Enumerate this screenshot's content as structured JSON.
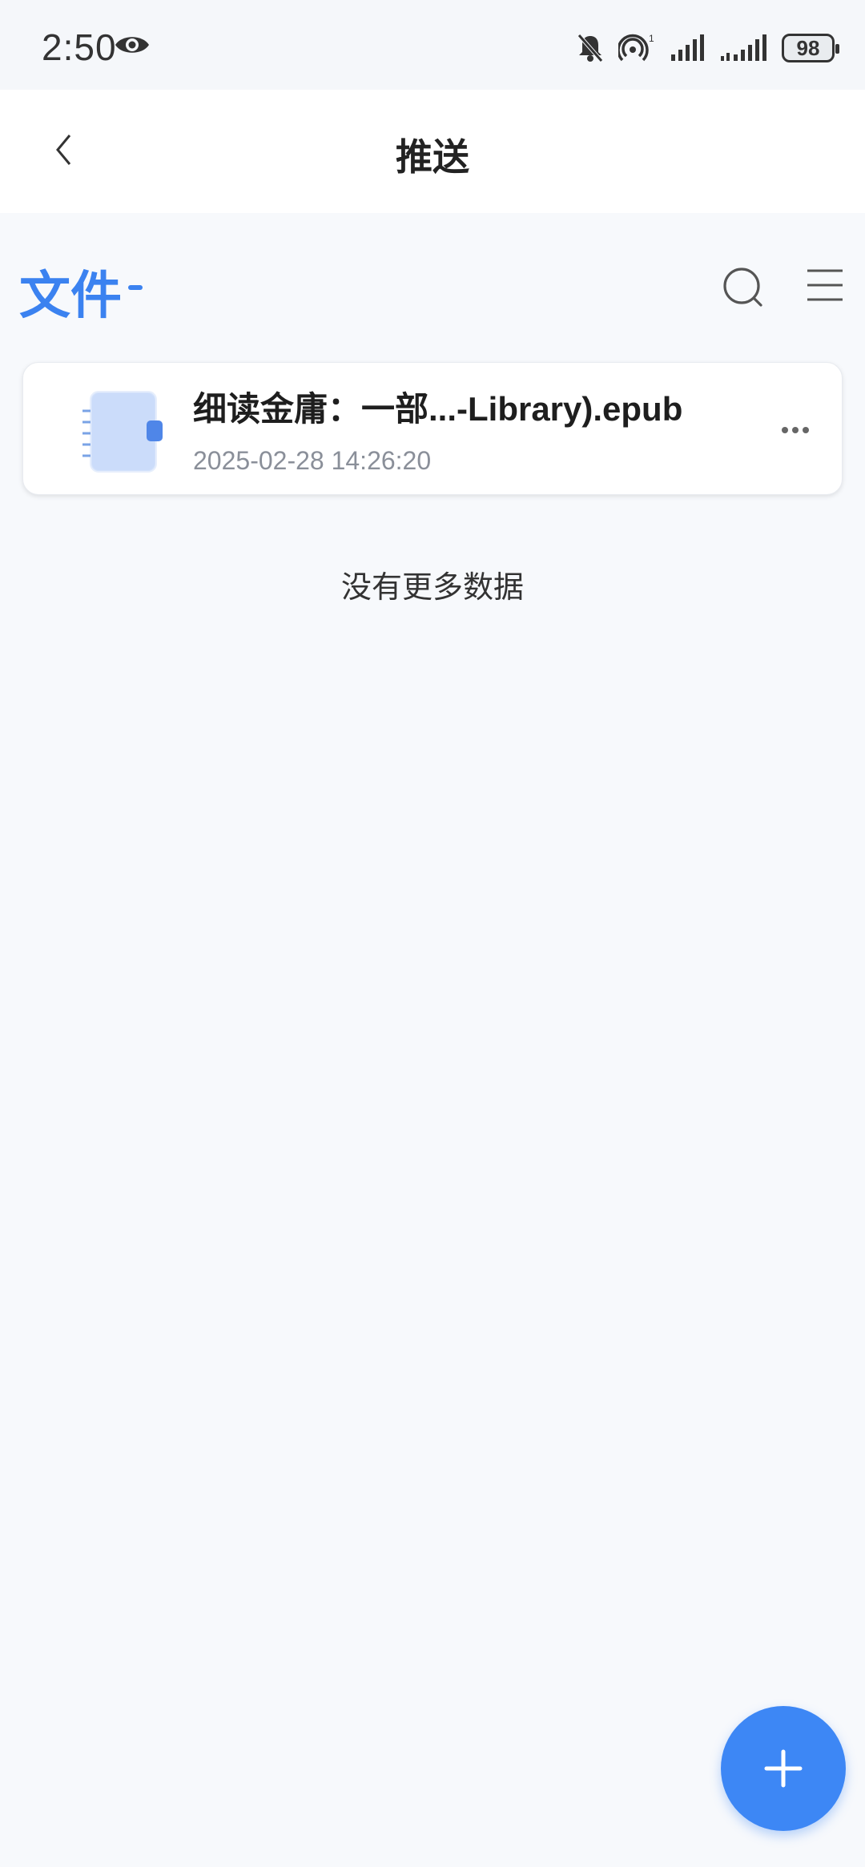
{
  "status_bar": {
    "time": "2:50",
    "battery": "98",
    "icons": [
      "eye-icon",
      "mute-bell-icon",
      "hotspot-icon",
      "signal-icon",
      "signal-icon"
    ]
  },
  "header": {
    "title": "推送",
    "back_icon": "chevron-left-icon"
  },
  "section": {
    "title": "文件",
    "icons": [
      "search-icon",
      "menu-icon"
    ]
  },
  "files": [
    {
      "name": "细读金庸：一部...-Library).epub",
      "date": "2025-02-28 14:26:20",
      "icon": "notebook-icon"
    }
  ],
  "list_footer": "没有更多数据",
  "fab": {
    "icon": "plus-icon"
  },
  "colors": {
    "accent": "#3b82f0",
    "fab": "#3d87f5",
    "background": "#f7f9fc"
  }
}
